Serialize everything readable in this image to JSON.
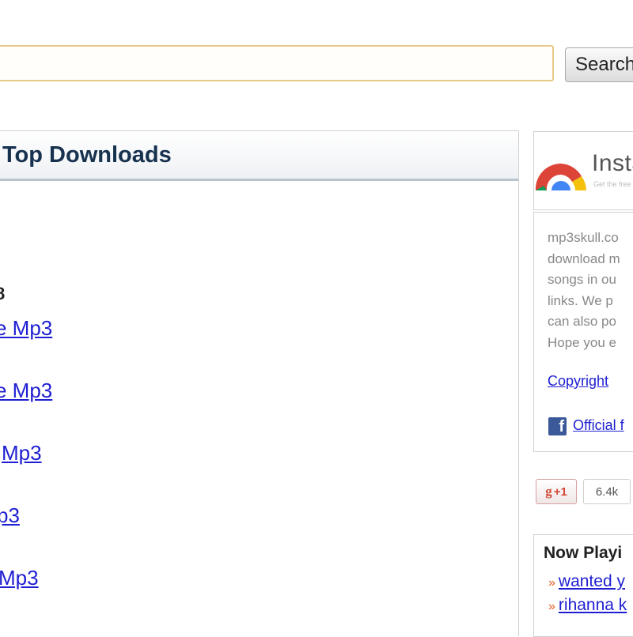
{
  "search": {
    "input_value": "",
    "button_label": "Search"
  },
  "top_downloads": {
    "title": "Top Downloads",
    "count_text": "8",
    "items": [
      {
        "text": "e Mp3"
      },
      {
        "text": "e Mp3"
      },
      {
        "text": "Mp3"
      },
      {
        "text": "p3"
      },
      {
        "text": "Mp3"
      }
    ]
  },
  "sidebar": {
    "install": {
      "title": "Insta",
      "subtitle": "Get the free"
    },
    "info": {
      "lines": [
        "mp3skull.co",
        "download m",
        "songs in ou",
        "links. We p",
        "can also po",
        "Hope you e"
      ],
      "copyright_link": "Copyright",
      "facebook_link": "Official f"
    },
    "social": {
      "gplus_label": "+1",
      "gplus_count": "6.4k"
    },
    "now_playing": {
      "title": "Now Playi",
      "items": [
        {
          "text": "wanted y"
        },
        {
          "text": "rihanna k"
        }
      ]
    }
  },
  "colors": {
    "link": "#1e1ed2",
    "header_text": "#17324f",
    "search_border": "#e7c98a",
    "facebook": "#3b5998",
    "gplus_red": "#d14836",
    "bullet_orange": "#e35b1e"
  }
}
